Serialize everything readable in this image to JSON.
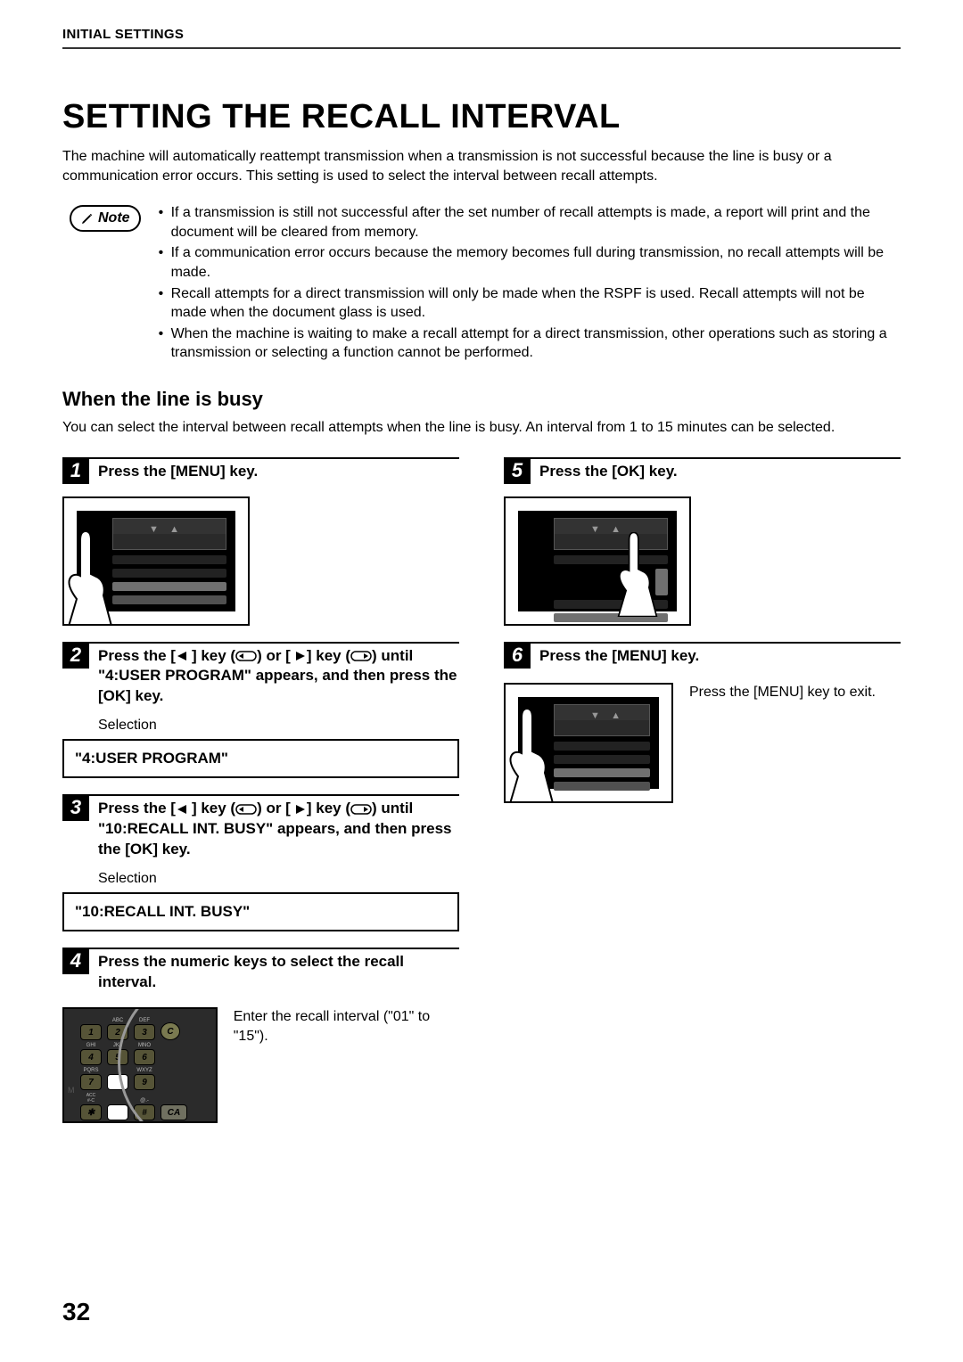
{
  "header": {
    "section": "INITIAL SETTINGS"
  },
  "title": "SETTING THE RECALL INTERVAL",
  "intro": "The machine will automatically reattempt transmission when a transmission is not successful because the line is busy or a communication error occurs. This setting is used to select the interval between recall attempts.",
  "note": {
    "label": "Note",
    "items": [
      "If a transmission is still not successful after the set number of recall attempts is made, a report will print and the document will be cleared from memory.",
      "If a communication error occurs because the memory becomes full during transmission, no recall attempts will be made.",
      "Recall attempts for a direct transmission will only be made when the RSPF is used. Recall attempts will not be made when the document glass is used.",
      "When the machine is waiting to make a recall attempt for a direct transmission, other operations such as storing a transmission or selecting a function cannot be performed."
    ]
  },
  "subhead": "When the line is busy",
  "subdesc": "You can select the interval between recall attempts when the line is busy. An interval from 1 to 15 minutes can be selected.",
  "steps": {
    "s1": {
      "num": "1",
      "text": "Press the [MENU] key."
    },
    "s2": {
      "num": "2",
      "text_a": "Press the [",
      "text_b": "] key (",
      "text_c": ") or [",
      "text_d": "] key (",
      "text_e": ") until \"4:USER PROGRAM\" appears, and then press the [OK] key.",
      "selection_label": "Selection",
      "selection_value": "\"4:USER PROGRAM\""
    },
    "s3": {
      "num": "3",
      "text_a": "Press the [",
      "text_b": "] key (",
      "text_c": ") or [",
      "text_d": "] key (",
      "text_e": ") until \"10:RECALL INT. BUSY\" appears, and then press the [OK] key.",
      "selection_label": "Selection",
      "selection_value": "\"10:RECALL INT. BUSY\""
    },
    "s4": {
      "num": "4",
      "text": "Press the numeric keys to select the recall interval.",
      "body": "Enter the recall interval (\"01\" to \"15\")."
    },
    "s5": {
      "num": "5",
      "text": "Press the [OK] key."
    },
    "s6": {
      "num": "6",
      "text": "Press the [MENU] key.",
      "body": "Press the [MENU] key to exit."
    }
  },
  "keypad": {
    "labels": {
      "r1c2": "ABC",
      "r1c3": "DEF",
      "r2c1": "GHI",
      "r2c2": "JKL",
      "r2c3": "MNO",
      "r3c1": "PQRS",
      "r3c3": "WXYZ",
      "r4c3": "@.-",
      "acc": "ACC\n#-C"
    },
    "keys": {
      "k1": "1",
      "k2": "2",
      "k3": "3",
      "kC": "C",
      "k4": "4",
      "k5": "5",
      "k6": "6",
      "k7": "7",
      "k9": "9",
      "kstar": "✱",
      "khash": "#",
      "kCA": "CA"
    }
  },
  "page_number": "32"
}
